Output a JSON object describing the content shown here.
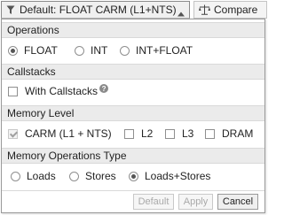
{
  "toolbar": {
    "dropdown_label": "Default: FLOAT CARM (L1+NTS)",
    "compare_label": "Compare"
  },
  "sections": {
    "operations": {
      "title": "Operations",
      "options": [
        {
          "label": "FLOAT",
          "selected": true
        },
        {
          "label": "INT",
          "selected": false
        },
        {
          "label": "INT+FLOAT",
          "selected": false
        }
      ]
    },
    "callstacks": {
      "title": "Callstacks",
      "with_callstacks_label": "With Callstacks",
      "with_callstacks_checked": false
    },
    "memory_level": {
      "title": "Memory Level",
      "options": [
        {
          "label": "CARM (L1 + NTS)",
          "checked": true,
          "disabled": true
        },
        {
          "label": "L2",
          "checked": false
        },
        {
          "label": "L3",
          "checked": false
        },
        {
          "label": "DRAM",
          "checked": false
        }
      ]
    },
    "memory_operations_type": {
      "title": "Memory Operations Type",
      "options": [
        {
          "label": "Loads",
          "selected": false
        },
        {
          "label": "Stores",
          "selected": false
        },
        {
          "label": "Loads+Stores",
          "selected": true
        }
      ]
    }
  },
  "footer": {
    "default_label": "Default",
    "apply_label": "Apply",
    "cancel_label": "Cancel"
  },
  "icons": {
    "filter": "filter-icon",
    "caret": "caret-up-icon",
    "compare": "scale-icon",
    "help": "help-icon"
  }
}
